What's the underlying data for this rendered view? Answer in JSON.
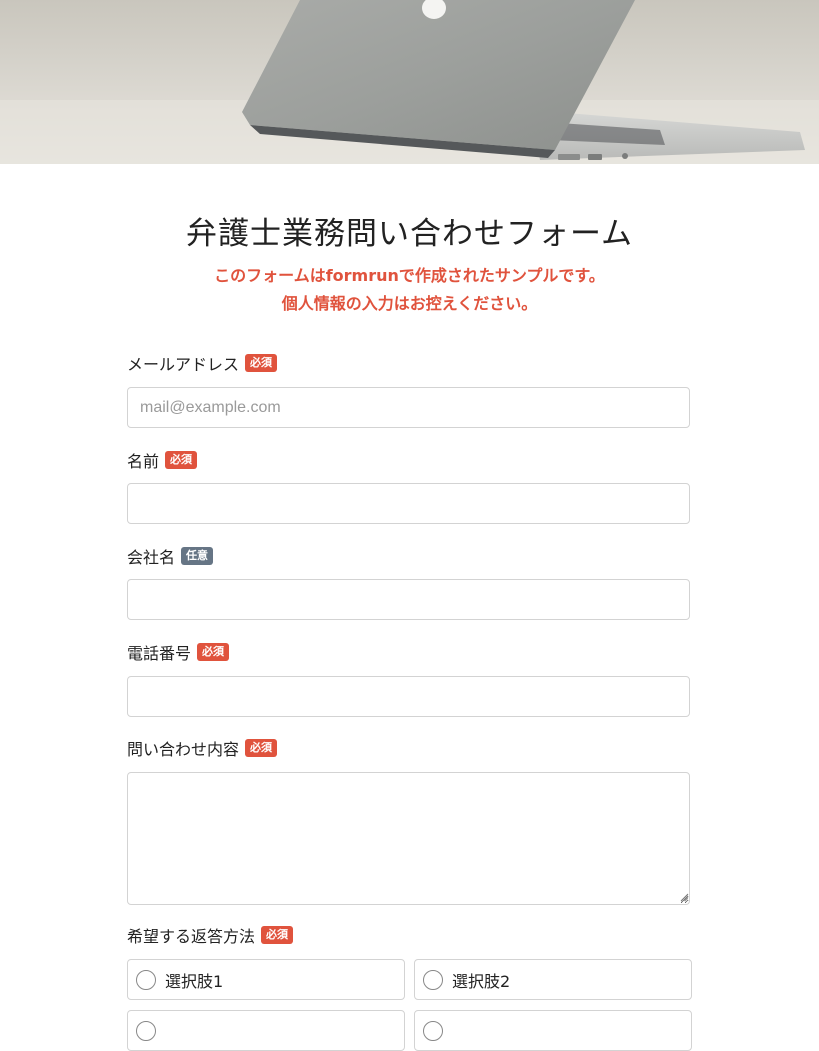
{
  "header": {
    "image_description": "laptop-photo"
  },
  "form": {
    "title": "弁護士業務問い合わせフォーム",
    "notice_line1": "このフォームはformrunで作成されたサンプルです。",
    "notice_line2": "個人情報の入力はお控えください。",
    "fields": {
      "email": {
        "label": "メールアドレス",
        "badge": "必須",
        "placeholder": "mail@example.com",
        "value": ""
      },
      "name": {
        "label": "名前",
        "badge": "必須",
        "value": ""
      },
      "company": {
        "label": "会社名",
        "badge": "任意",
        "value": ""
      },
      "phone": {
        "label": "電話番号",
        "badge": "必須",
        "value": ""
      },
      "inquiry": {
        "label": "問い合わせ内容",
        "badge": "必須",
        "value": ""
      },
      "reply_method": {
        "label": "希望する返答方法",
        "badge": "必須",
        "options": [
          "選択肢1",
          "選択肢2"
        ]
      }
    }
  },
  "colors": {
    "required_badge": "#e0533d",
    "optional_badge": "#667585",
    "notice_text": "#e0533d"
  }
}
